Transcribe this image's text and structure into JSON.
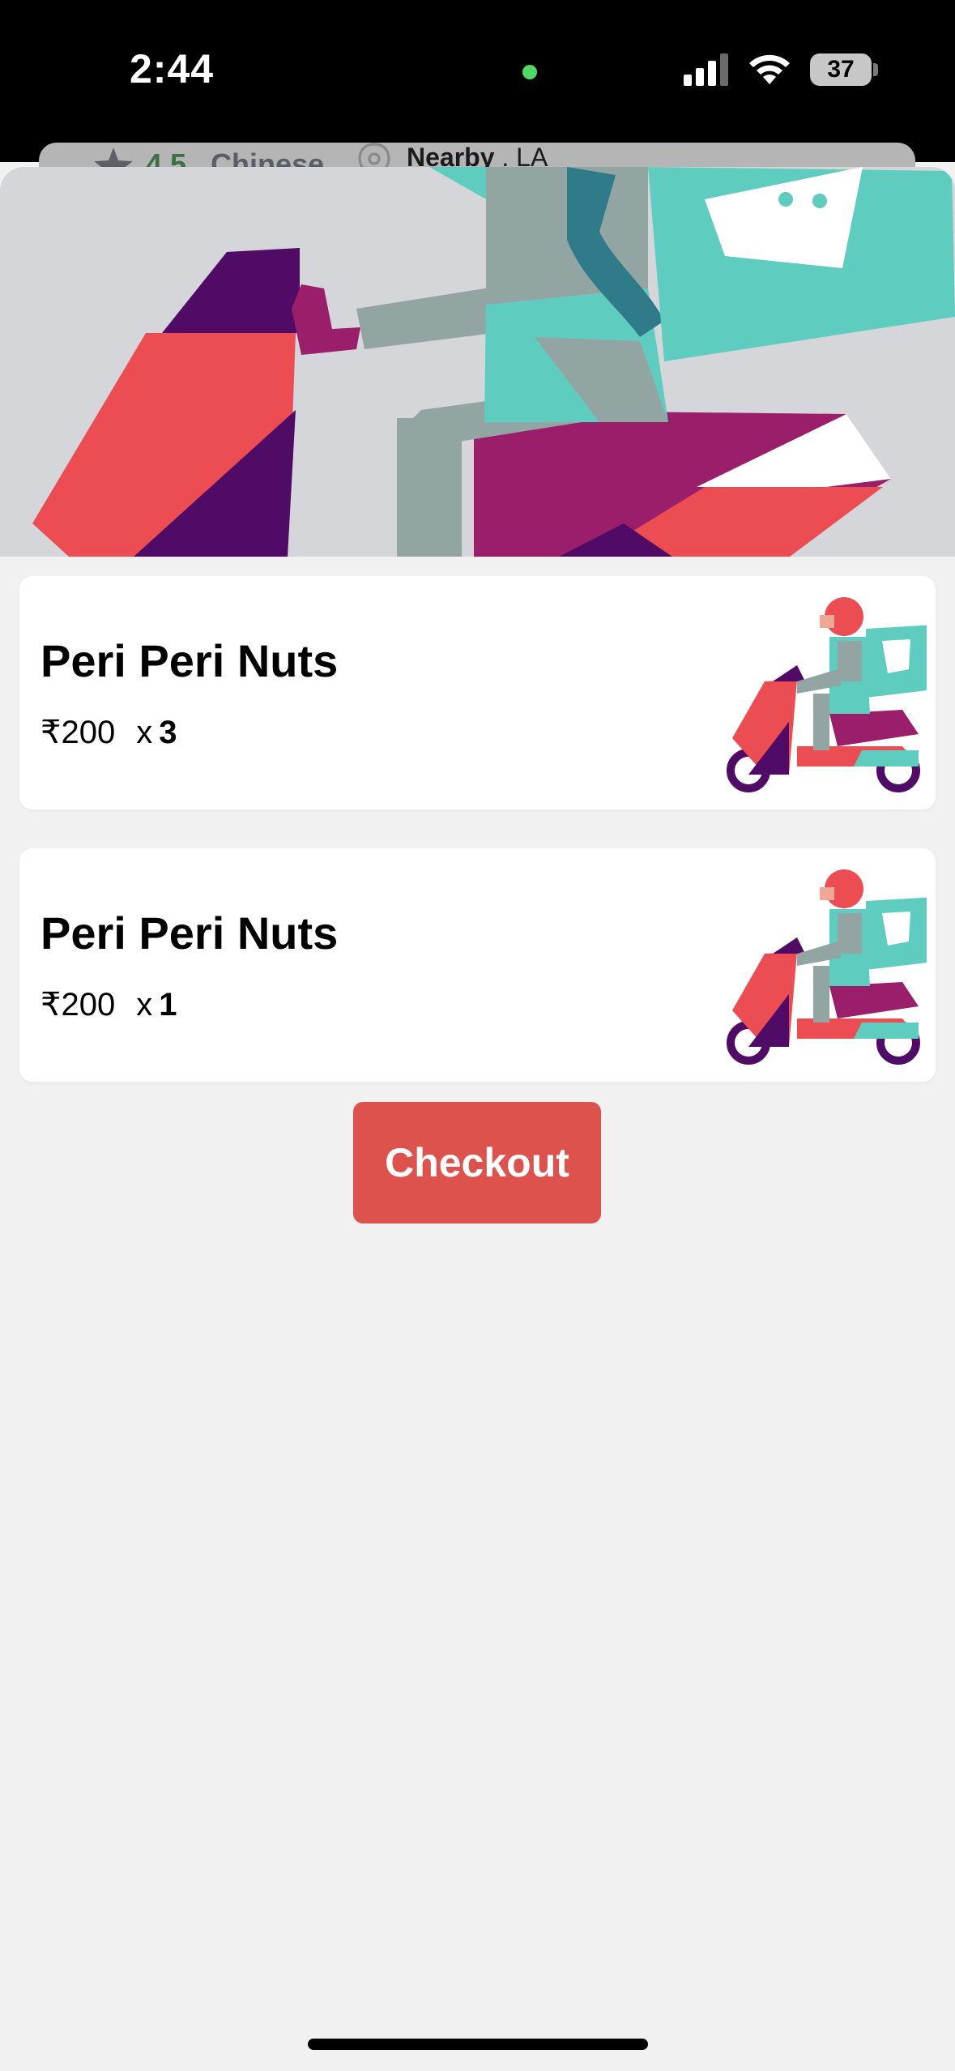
{
  "status_bar": {
    "time": "2:44",
    "battery": "37"
  },
  "behind_card": {
    "rating": "4.5",
    "separator": " . ",
    "cuisine": "Chinese",
    "location_label": "Nearby",
    "location_sep": " . ",
    "location_city": "LA"
  },
  "cart": {
    "items": [
      {
        "name": "Peri Peri Nuts",
        "price": "₹200",
        "qty_prefix": "x",
        "qty": "3"
      },
      {
        "name": "Peri Peri Nuts",
        "price": "₹200",
        "qty_prefix": "x",
        "qty": "1"
      }
    ],
    "checkout_label": "Checkout"
  },
  "colors": {
    "accent": "#dd524c",
    "rating_green": "#3d6f44",
    "hero_bg": "#d5d6da"
  },
  "icons": [
    "star-icon",
    "location-pin-icon",
    "signal-icon",
    "wifi-icon",
    "battery-icon"
  ]
}
